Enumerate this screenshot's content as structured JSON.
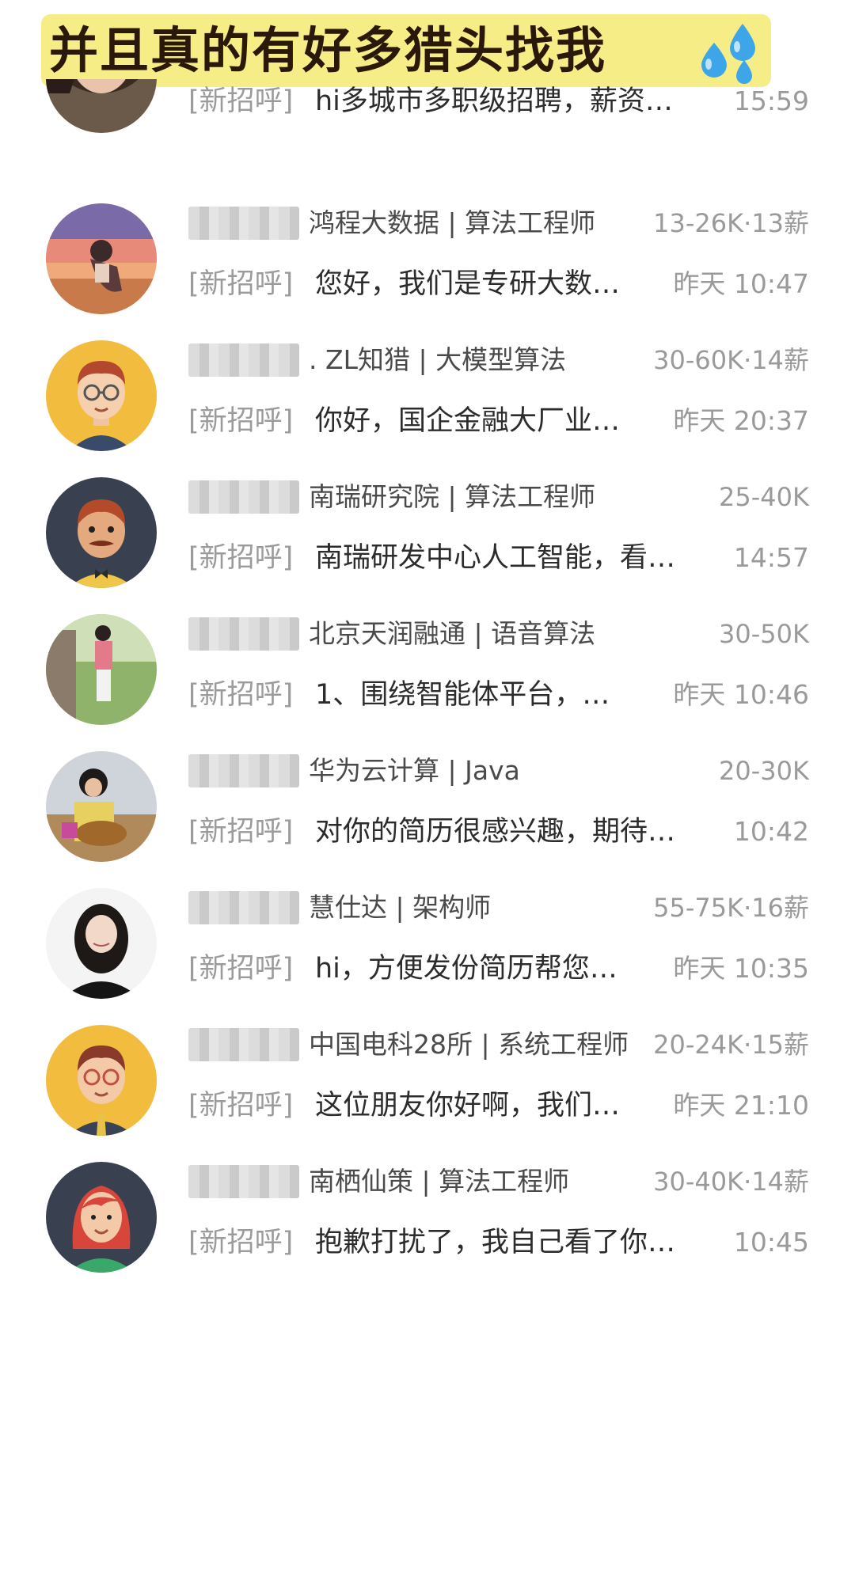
{
  "banner": {
    "title": "并且真的有好多猎头找我",
    "emoji": "sweat-droplets-icon"
  },
  "tag_label": "[新招呼]",
  "messages": [
    {
      "company": "",
      "salary": "",
      "preview": "hi多城市多职级招聘，薪资…",
      "time": "15:59"
    },
    {
      "company": "鸿程大数据 | 算法工程师",
      "salary": "13-26K·13薪",
      "preview": "您好，我们是专研大数…",
      "time": "昨天 10:47"
    },
    {
      "company": ". ZL知猎 | 大模型算法",
      "salary": "30-60K·14薪",
      "preview": "你好，国企金融大厂业…",
      "time": "昨天 20:37"
    },
    {
      "company": "南瑞研究院 | 算法工程师",
      "salary": "25-40K",
      "preview": "南瑞研发中心人工智能，看…",
      "time": "14:57"
    },
    {
      "company": "北京天润融通 | 语音算法",
      "salary": "30-50K",
      "preview": "1、围绕智能体平台，…",
      "time": "昨天 10:46"
    },
    {
      "company": "华为云计算 | Java",
      "salary": "20-30K",
      "preview": "对你的简历很感兴趣，期待…",
      "time": "10:42"
    },
    {
      "company": "慧仕达 | 架构师",
      "salary": "55-75K·16薪",
      "preview": "hi，方便发份简历帮您…",
      "time": "昨天 10:35"
    },
    {
      "company": "中国电科28所 | 系统工程师",
      "salary": "20-24K·15薪",
      "preview": "这位朋友你好啊，我们…",
      "time": "昨天 21:10"
    },
    {
      "company": "南栖仙策 | 算法工程师",
      "salary": "30-40K·14薪",
      "preview": "抱歉打扰了，我自己看了你…",
      "time": "10:45"
    }
  ]
}
